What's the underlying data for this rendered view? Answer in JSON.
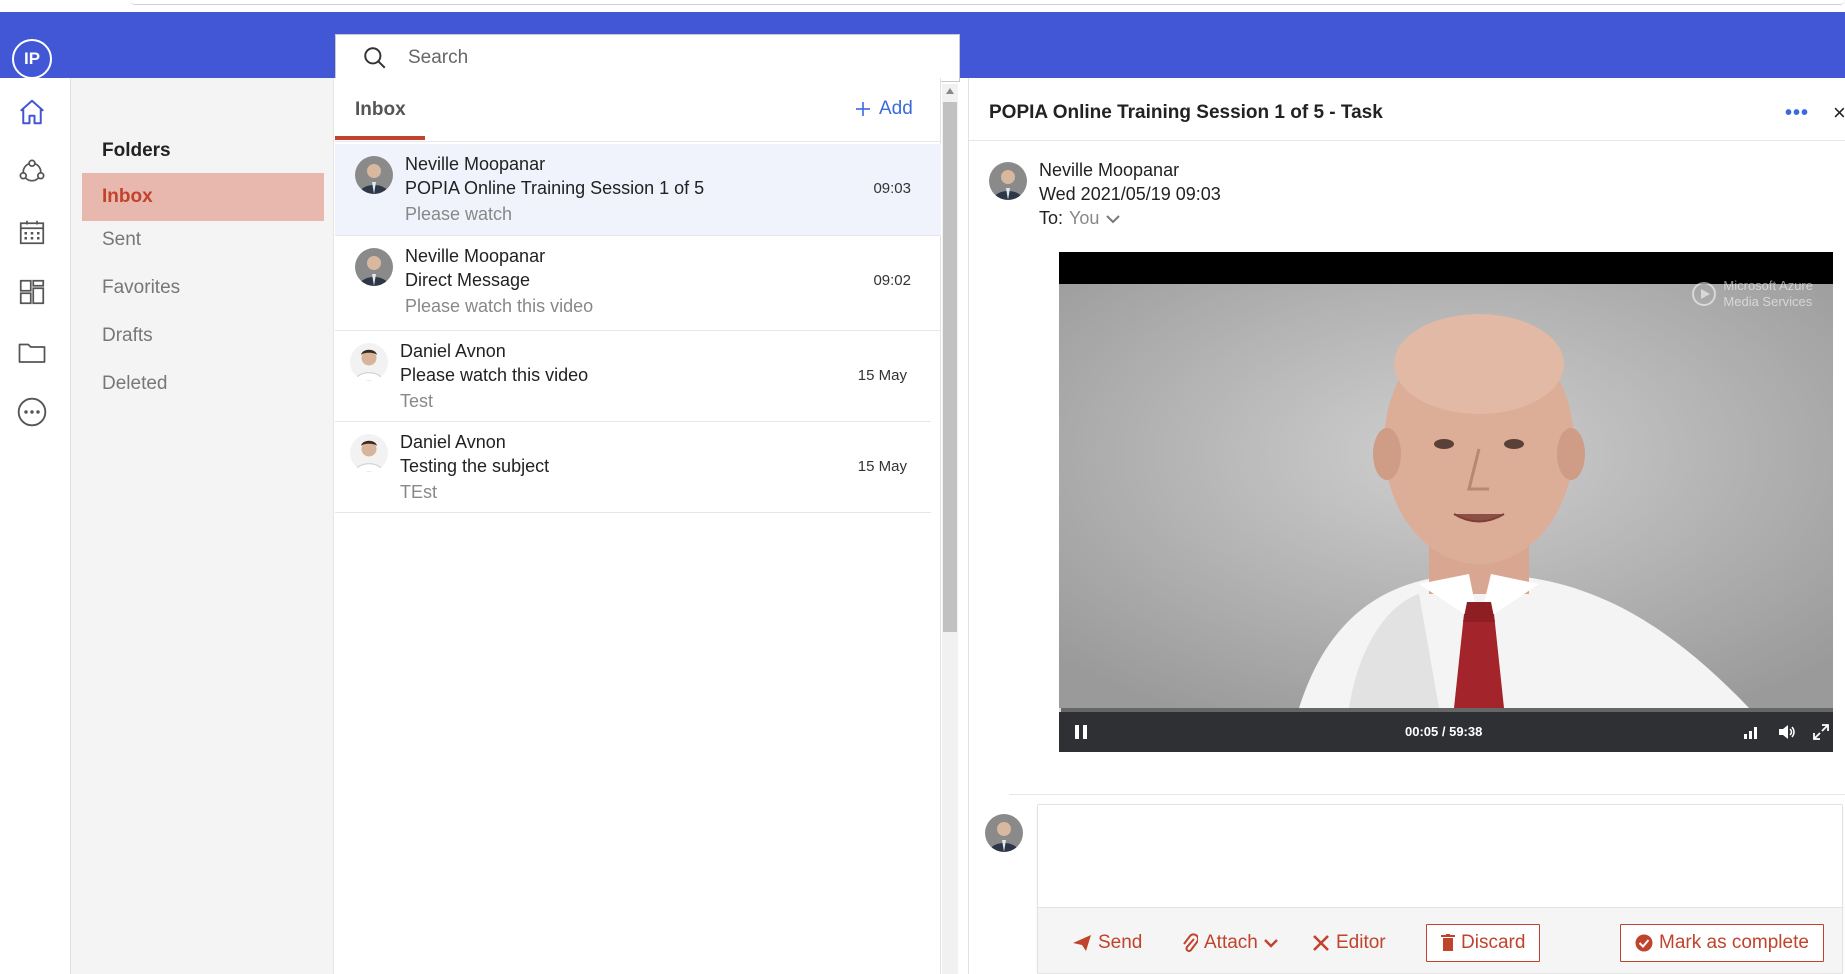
{
  "header": {
    "user_initials": "IP",
    "search_placeholder": "Search"
  },
  "rail": {
    "icons": [
      "home-icon",
      "network-icon",
      "calendar-icon",
      "dashboard-icon",
      "folder-icon",
      "more-icon"
    ]
  },
  "folders": {
    "title": "Folders",
    "items": [
      {
        "label": "Inbox",
        "active": true
      },
      {
        "label": "Sent",
        "active": false
      },
      {
        "label": "Favorites",
        "active": false
      },
      {
        "label": "Drafts",
        "active": false
      },
      {
        "label": "Deleted",
        "active": false
      }
    ]
  },
  "list": {
    "tab_label": "Inbox",
    "add_label": "Add",
    "messages": [
      {
        "from": "Neville Moopanar",
        "subject": "POPIA Online Training Session 1 of 5",
        "preview": "Please watch",
        "time": "09:03",
        "selected": true
      },
      {
        "from": "Neville Moopanar",
        "subject": "Direct Message",
        "preview": "Please watch this video",
        "time": "09:02",
        "selected": false
      },
      {
        "from": "Daniel Avnon",
        "subject": "Please watch this video",
        "preview": "Test",
        "time": "15 May",
        "selected": false
      },
      {
        "from": "Daniel Avnon",
        "subject": "Testing the subject",
        "preview": "TEst",
        "time": "15 May",
        "selected": false
      }
    ]
  },
  "reading": {
    "title": "POPIA Online Training Session 1 of 5 - Task",
    "more_label": "•••",
    "close_label": "×",
    "from": "Neville Moopanar",
    "date": "Wed 2021/05/19 09:03",
    "to_label": "To:",
    "to_value": "You",
    "video": {
      "watermark_line1": "Microsoft Azure",
      "watermark_line2": "Media Services",
      "time_display": "00:05 / 59:38",
      "progress_fraction": 0.0014
    }
  },
  "compose": {
    "placeholder": "",
    "send_label": "Send",
    "attach_label": "Attach",
    "editor_label": "Editor",
    "discard_label": "Discard",
    "complete_label": "Mark as complete"
  },
  "colors": {
    "header_blue": "#4257d6",
    "accent_red": "#c0432c",
    "active_folder_bg": "#e8b7ae",
    "link_blue": "#3a6bdc"
  }
}
